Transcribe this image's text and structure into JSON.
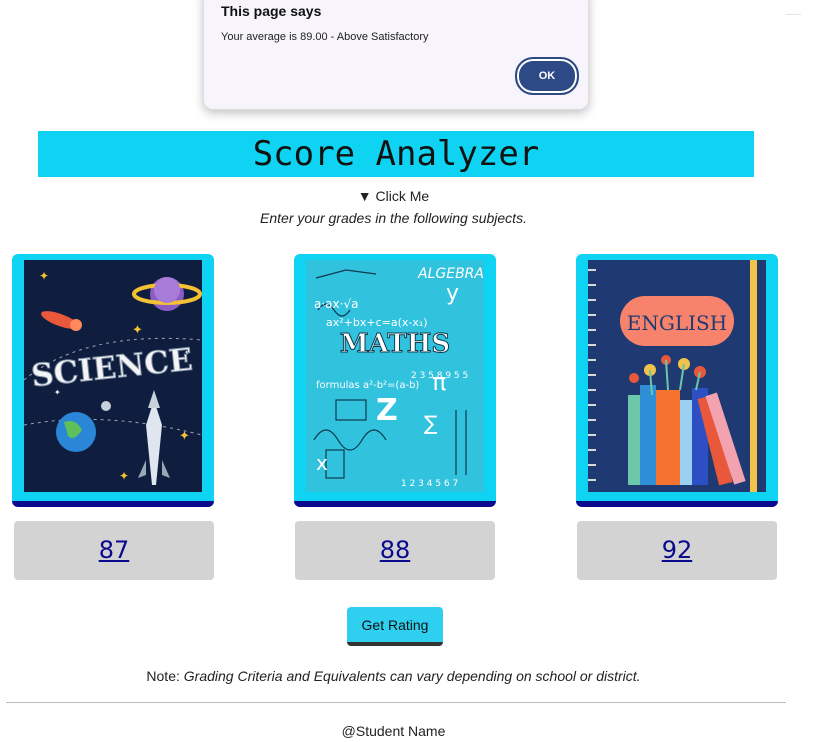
{
  "dialog": {
    "title": "This page says",
    "message": "Your average is 89.00 - Above Satisfactory",
    "ok_label": "OK"
  },
  "header": {
    "title": "Score Analyzer"
  },
  "details": {
    "summary": "▼ Click Me",
    "instructions": "Enter your grades in the following subjects."
  },
  "subjects": [
    {
      "cover_text": "SCIENCE",
      "score": "87"
    },
    {
      "cover_text": "MATHS",
      "cover_top": "ALGEBRA",
      "score": "88"
    },
    {
      "cover_text": "ENGLISH",
      "score": "92"
    }
  ],
  "actions": {
    "rating_label": "Get Rating"
  },
  "note": {
    "prefix": "Note: ",
    "text": "Grading Criteria and Equivalents can vary depending on school or district."
  },
  "footer": {
    "text": "@Student Name"
  },
  "colors": {
    "accent": "#0fd3f2",
    "card_border": "#0a0a8c",
    "link": "#0a0a8c",
    "dialog_button": "#2e4a86"
  }
}
